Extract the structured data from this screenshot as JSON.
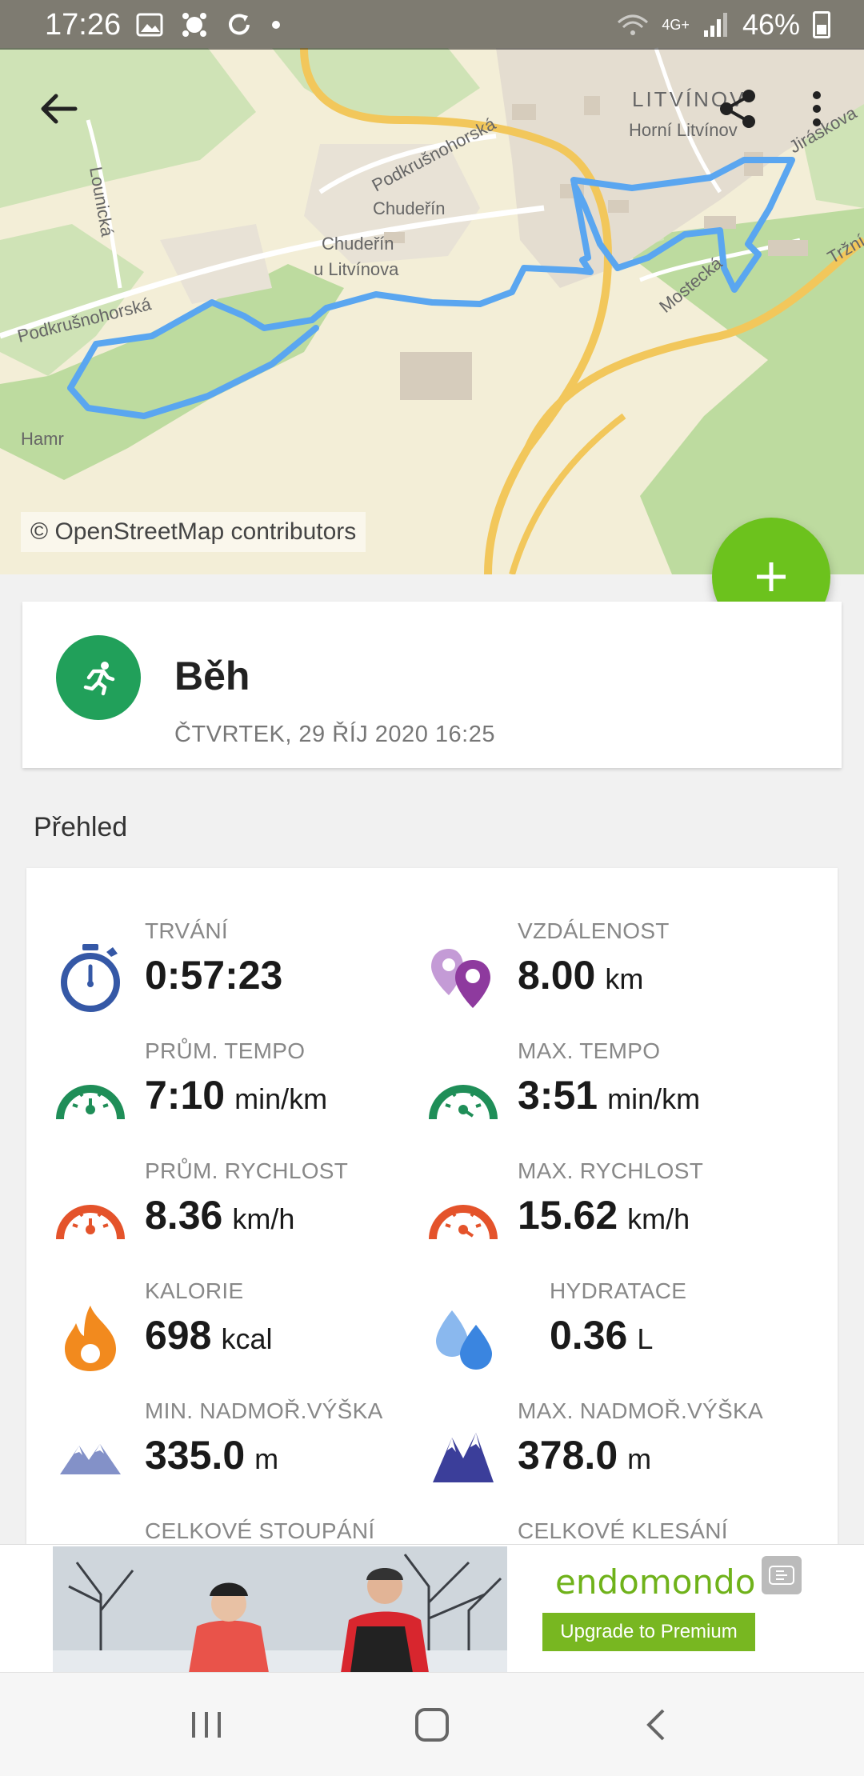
{
  "status_bar": {
    "time": "17:26",
    "network": "4G+",
    "battery": "46%"
  },
  "map": {
    "attribution": "© OpenStreetMap contributors",
    "labels": {
      "litvinov": "LITVÍNOV",
      "horni_litvinov": "Horní Litvínov",
      "podkrusnohorska_1": "Podkrušnohorská",
      "podkrusnohorska_2": "Podkrušnohorská",
      "chuderin": "Chudeřín",
      "chuderin_u": "Chudeřín",
      "u_litvinova": "u Litvínova",
      "lounicka": "Lounická",
      "mostecka": "Mostecká",
      "jiraskova": "Jiráskova",
      "trzni": "Tržní",
      "hamr": "Hamr"
    },
    "route_color": "#5aa6f0"
  },
  "toolbar": {
    "back_icon": "arrow-left-icon",
    "share_icon": "share-icon",
    "more_icon": "more-vertical-icon"
  },
  "fab": {
    "icon": "plus-icon",
    "color": "#6cc21d"
  },
  "activity": {
    "title": "Běh",
    "date": "ČTVRTEK, 29 ŘÍJ 2020 16:25",
    "icon": "running-icon",
    "color": "#21a05a"
  },
  "overview": {
    "title": "Přehled",
    "stats": [
      {
        "id": "duration",
        "label": "TRVÁNÍ",
        "value": "0:57:23",
        "unit": "",
        "icon": "stopwatch-icon"
      },
      {
        "id": "distance",
        "label": "VZDÁLENOST",
        "value": "8.00",
        "unit": "km",
        "icon": "location-pins-icon"
      },
      {
        "id": "avg_pace",
        "label": "PRŮM. TEMPO",
        "value": "7:10",
        "unit": "min/km",
        "icon": "gauge-green-icon"
      },
      {
        "id": "max_pace",
        "label": "MAX. TEMPO",
        "value": "3:51",
        "unit": "min/km",
        "icon": "gauge-green-max-icon"
      },
      {
        "id": "avg_speed",
        "label": "PRŮM. RYCHLOST",
        "value": "8.36",
        "unit": "km/h",
        "icon": "gauge-orange-icon"
      },
      {
        "id": "max_speed",
        "label": "MAX. RYCHLOST",
        "value": "15.62",
        "unit": "km/h",
        "icon": "gauge-orange-max-icon"
      },
      {
        "id": "calories",
        "label": "KALORIE",
        "value": "698",
        "unit": "kcal",
        "icon": "flame-icon"
      },
      {
        "id": "hydration",
        "label": "HYDRATACE",
        "value": "0.36",
        "unit": "L",
        "icon": "water-drops-icon"
      },
      {
        "id": "min_alt",
        "label": "MIN. NADMOŘ.VÝŠKA",
        "value": "335.0",
        "unit": "m",
        "icon": "mountain-light-icon"
      },
      {
        "id": "max_alt",
        "label": "MAX. NADMOŘ.VÝŠKA",
        "value": "378.0",
        "unit": "m",
        "icon": "mountain-dark-icon"
      },
      {
        "id": "ascent",
        "label": "CELKOVÉ STOUPÁNÍ",
        "value": "",
        "unit": "",
        "icon": "ascent-icon"
      },
      {
        "id": "descent",
        "label": "CELKOVÉ KLESÁNÍ",
        "value": "",
        "unit": "",
        "icon": "descent-icon"
      }
    ]
  },
  "ad": {
    "brand": "endomondo",
    "cta": "Upgrade to Premium"
  },
  "nav": {
    "recents_icon": "recents-icon",
    "home_icon": "home-icon",
    "back_icon": "nav-back-icon"
  }
}
